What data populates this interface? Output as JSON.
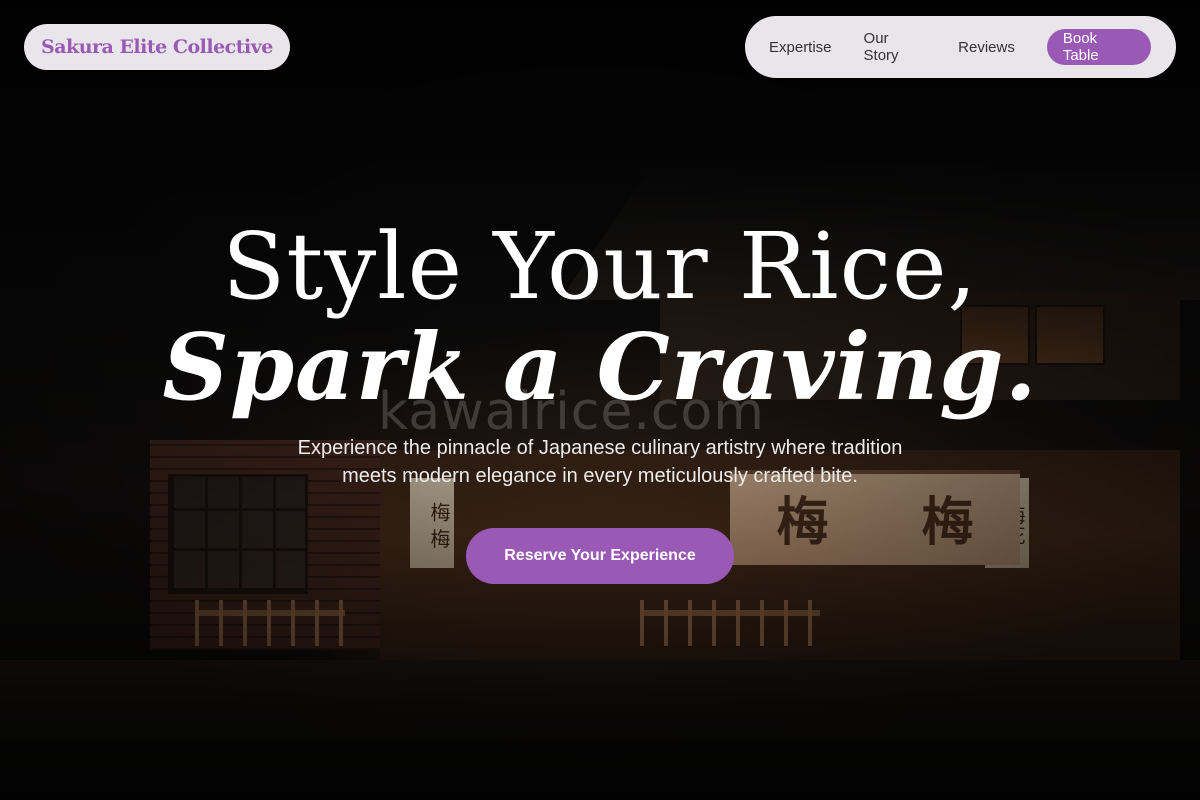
{
  "header": {
    "brand": "Sakura Elite Collective",
    "nav": [
      "Expertise",
      "Our Story",
      "Reviews"
    ],
    "book_label": "Book Table"
  },
  "hero": {
    "title_line1": "Style Your Rice,",
    "title_line2": "Spark a Craving.",
    "subtitle": "Experience the pinnacle of Japanese culinary artistry where tradition meets modern elegance in every meticulously crafted bite.",
    "cta_label": "Reserve Your Experience",
    "watermark": "kawairice.com",
    "noren_glyphs": [
      "梅",
      "梅"
    ],
    "side_sign_left": "梅 梅",
    "side_sign_right": "梅花"
  },
  "colors": {
    "accent": "#9b59b6",
    "pill_bg": "#e8e6ea"
  }
}
